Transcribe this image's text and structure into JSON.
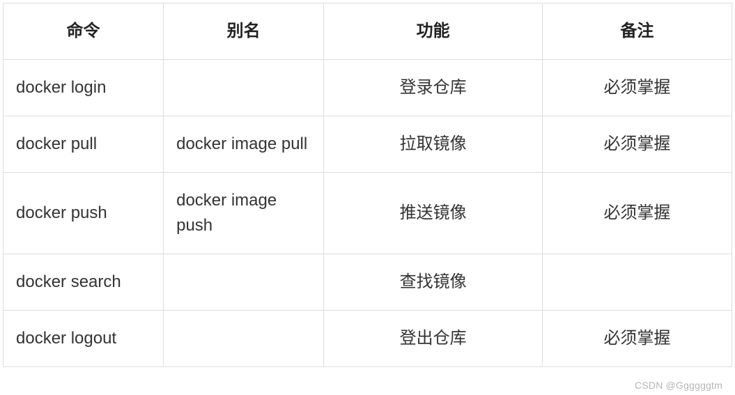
{
  "table": {
    "headers": {
      "command": "命令",
      "alias": "别名",
      "function": "功能",
      "note": "备注"
    },
    "rows": [
      {
        "command": "docker login",
        "alias": "",
        "function": "登录仓库",
        "note": "必须掌握"
      },
      {
        "command": "docker pull",
        "alias": "docker image pull",
        "function": "拉取镜像",
        "note": "必须掌握"
      },
      {
        "command": "docker push",
        "alias": "docker image push",
        "function": "推送镜像",
        "note": "必须掌握"
      },
      {
        "command": "docker search",
        "alias": "",
        "function": "查找镜像",
        "note": ""
      },
      {
        "command": "docker logout",
        "alias": "",
        "function": "登出仓库",
        "note": "必须掌握"
      }
    ]
  },
  "watermark": "CSDN @Ggggggtm"
}
